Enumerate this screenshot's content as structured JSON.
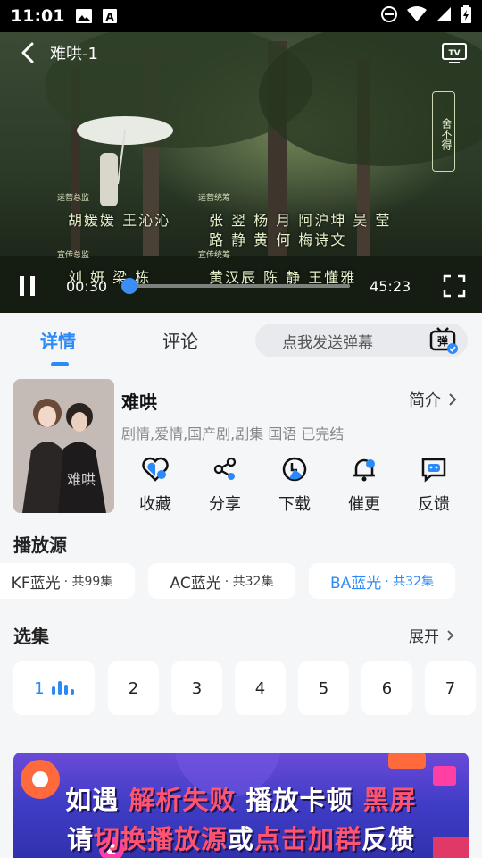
{
  "status_bar": {
    "time": "11:01"
  },
  "player": {
    "title": "难哄-1",
    "current_time": "00:30",
    "total_time": "45:23",
    "progress": 0.011,
    "credits": [
      {
        "role": "运营总监",
        "names": "胡媛媛   王沁沁"
      },
      {
        "role": "运营统筹",
        "names": "张  翌  杨  月  阿沪坤  吴  莹"
      },
      {
        "role": "",
        "names": "路  静  黄  何  梅诗文"
      },
      {
        "role": "宣传总监",
        "names": "刘  妍  梁  栋"
      },
      {
        "role": "宣传统筹",
        "names": "黄汉辰  陈  静  王懂雅"
      }
    ],
    "watermark": "舍不得"
  },
  "tabs": {
    "details": "详情",
    "comments": "评论"
  },
  "danmu": {
    "placeholder": "点我发送弹幕",
    "icon_label": "弹"
  },
  "show": {
    "title": "难哄",
    "intro_label": "简介",
    "tags": "剧情,爱情,国产剧,剧集 国语 已完结"
  },
  "actions": [
    {
      "label": "收藏",
      "icon": "favorite-heart-icon"
    },
    {
      "label": "分享",
      "icon": "share-icon"
    },
    {
      "label": "下载",
      "icon": "download-icon"
    },
    {
      "label": "催更",
      "icon": "bell-icon"
    },
    {
      "label": "反馈",
      "icon": "feedback-icon"
    }
  ],
  "sources_section": {
    "title": "播放源",
    "items": [
      {
        "name": "KF蓝光",
        "count": "· 共99集"
      },
      {
        "name": "AC蓝光",
        "count": "· 共32集"
      },
      {
        "name": "BA蓝光",
        "count": "· 共32集"
      }
    ],
    "selected": "BA蓝光"
  },
  "episodes_section": {
    "title": "选集",
    "expand_label": "展开",
    "episodes": [
      "1",
      "2",
      "3",
      "4",
      "5",
      "6",
      "7"
    ],
    "current": "1"
  },
  "banner": {
    "line1_a": "如遇",
    "line1_b": "解析失败",
    "line1_c": "播放卡顿",
    "line1_d": "黑屏",
    "line2_a": "请",
    "line2_b": "切换播放源",
    "line2_c": "或",
    "line2_d": "点击加群",
    "line2_e": "反馈"
  },
  "colors": {
    "accent": "#2b8af7",
    "banner_highlight": "#ff5470"
  }
}
